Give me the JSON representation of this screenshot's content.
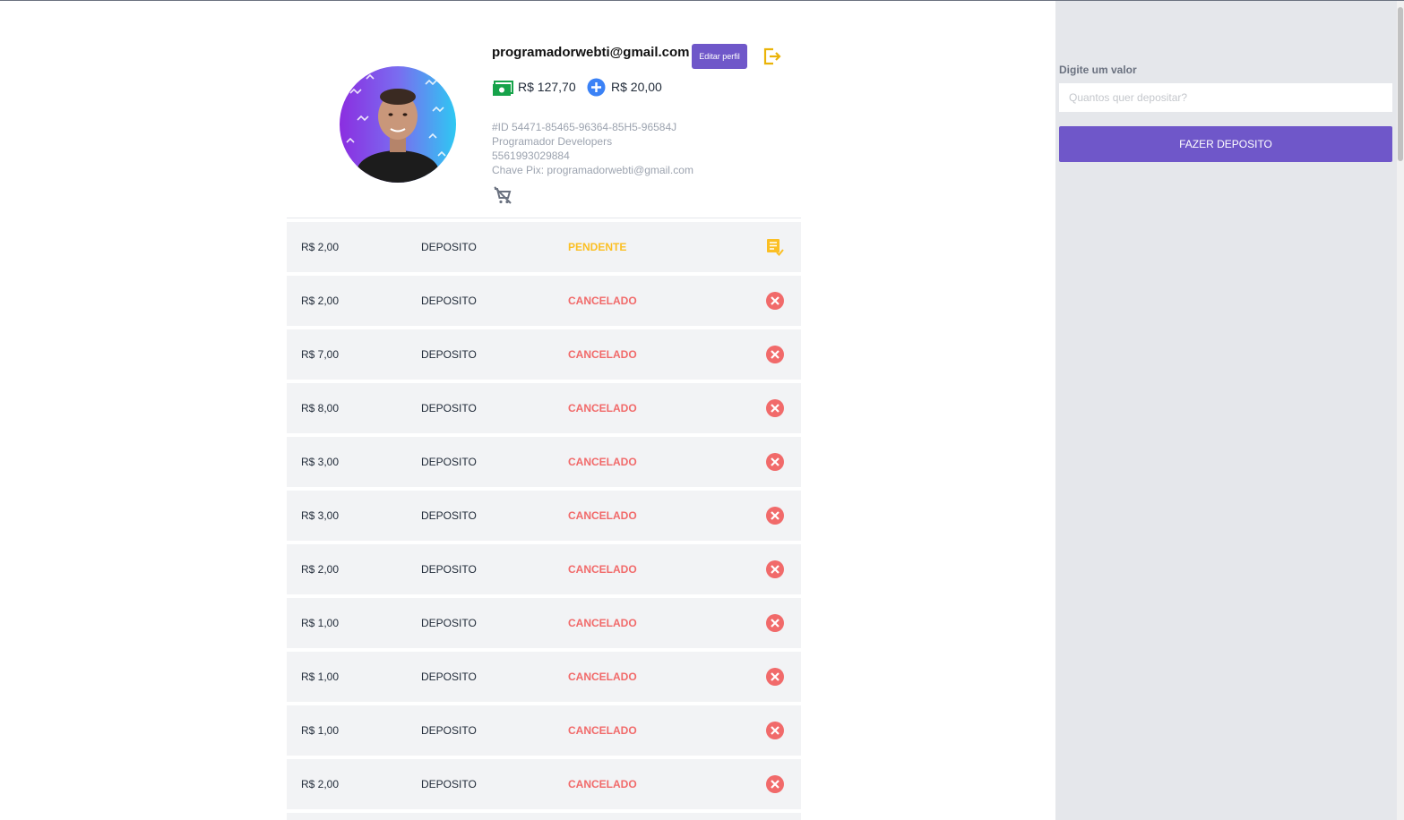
{
  "profile": {
    "email": "programadorwebti@gmail.com",
    "edit_label": "Editar perfil",
    "balance": "R$ 127,70",
    "bonus": "R$ 20,00",
    "id_text": "#ID 54471-85465-96364-85H5-96584J",
    "name": "Programador Developers",
    "phone": "5561993029884",
    "pix": "Chave Pix: programadorwebti@gmail.com"
  },
  "transactions": [
    {
      "amount": "R$ 2,00",
      "type": "DEPOSITO",
      "status": "PENDENTE",
      "icon": "receipt-check-icon"
    },
    {
      "amount": "R$ 2,00",
      "type": "DEPOSITO",
      "status": "CANCELADO",
      "icon": "cancel-icon"
    },
    {
      "amount": "R$ 7,00",
      "type": "DEPOSITO",
      "status": "CANCELADO",
      "icon": "cancel-icon"
    },
    {
      "amount": "R$ 8,00",
      "type": "DEPOSITO",
      "status": "CANCELADO",
      "icon": "cancel-icon"
    },
    {
      "amount": "R$ 3,00",
      "type": "DEPOSITO",
      "status": "CANCELADO",
      "icon": "cancel-icon"
    },
    {
      "amount": "R$ 3,00",
      "type": "DEPOSITO",
      "status": "CANCELADO",
      "icon": "cancel-icon"
    },
    {
      "amount": "R$ 2,00",
      "type": "DEPOSITO",
      "status": "CANCELADO",
      "icon": "cancel-icon"
    },
    {
      "amount": "R$ 1,00",
      "type": "DEPOSITO",
      "status": "CANCELADO",
      "icon": "cancel-icon"
    },
    {
      "amount": "R$ 1,00",
      "type": "DEPOSITO",
      "status": "CANCELADO",
      "icon": "cancel-icon"
    },
    {
      "amount": "R$ 1,00",
      "type": "DEPOSITO",
      "status": "CANCELADO",
      "icon": "cancel-icon"
    },
    {
      "amount": "R$ 2,00",
      "type": "DEPOSITO",
      "status": "CANCELADO",
      "icon": "cancel-icon"
    }
  ],
  "sidebar": {
    "label": "Digite um valor",
    "placeholder": "Quantos quer depositar?",
    "button_label": "FAZER DEPOSITO"
  },
  "colors": {
    "accent": "#6f57c9",
    "pending": "#fbbf24",
    "cancelled": "#f16a6a",
    "money": "#16a34a",
    "plus": "#3b82f6",
    "logout": "#eab308"
  }
}
